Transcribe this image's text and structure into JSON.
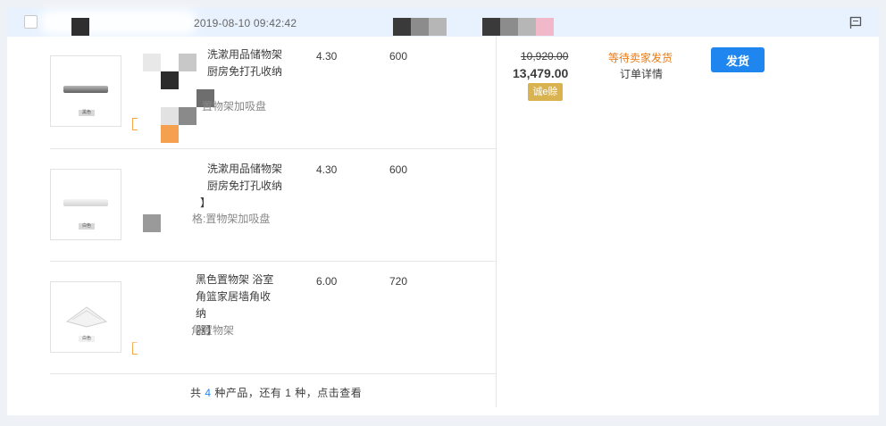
{
  "order": {
    "time": "2019-08-10 09:42:42",
    "original_total": "10,920.00",
    "total": "13,479.00",
    "credit_badge": "诚e赊",
    "status": "等待卖家发货",
    "detail_link": "订单详情",
    "ship_button": "发货"
  },
  "items": [
    {
      "title_lines": [
        "洗漱用品储物架",
        "厨房免打孔收纳"
      ],
      "sku": "置物架加吸盘",
      "price": "4.30",
      "qty": "600",
      "thumb_tag": "黑色",
      "thumb_color": "#7a7a7a"
    },
    {
      "title_lines": [
        "洗漱用品储物架",
        "厨房免打孔收纳",
        "】"
      ],
      "sku": "格:置物架加吸盘",
      "price": "4.30",
      "qty": "600",
      "thumb_tag": "白色",
      "thumb_color": "#e6e6e6"
    },
    {
      "title_lines": [
        "黑色置物架 浴室",
        "角篮家居墙角收纳",
        "器】"
      ],
      "sku": "角置物架",
      "price": "6.00",
      "qty": "720",
      "thumb_tag": "白色",
      "thumb_color": "#efefef"
    }
  ],
  "footer": {
    "prefix": "共 ",
    "product_count": "4",
    "middle": " 种产品，还有 ",
    "remaining_count": "1",
    "suffix": " 种，点击查看"
  },
  "colors": {
    "primary_blue": "#1f86f0",
    "status_orange": "#e87a13",
    "header_bg": "#e8f2ff",
    "credit_gold": "#d9b34f"
  },
  "icons": {
    "flag": "flag-icon"
  }
}
